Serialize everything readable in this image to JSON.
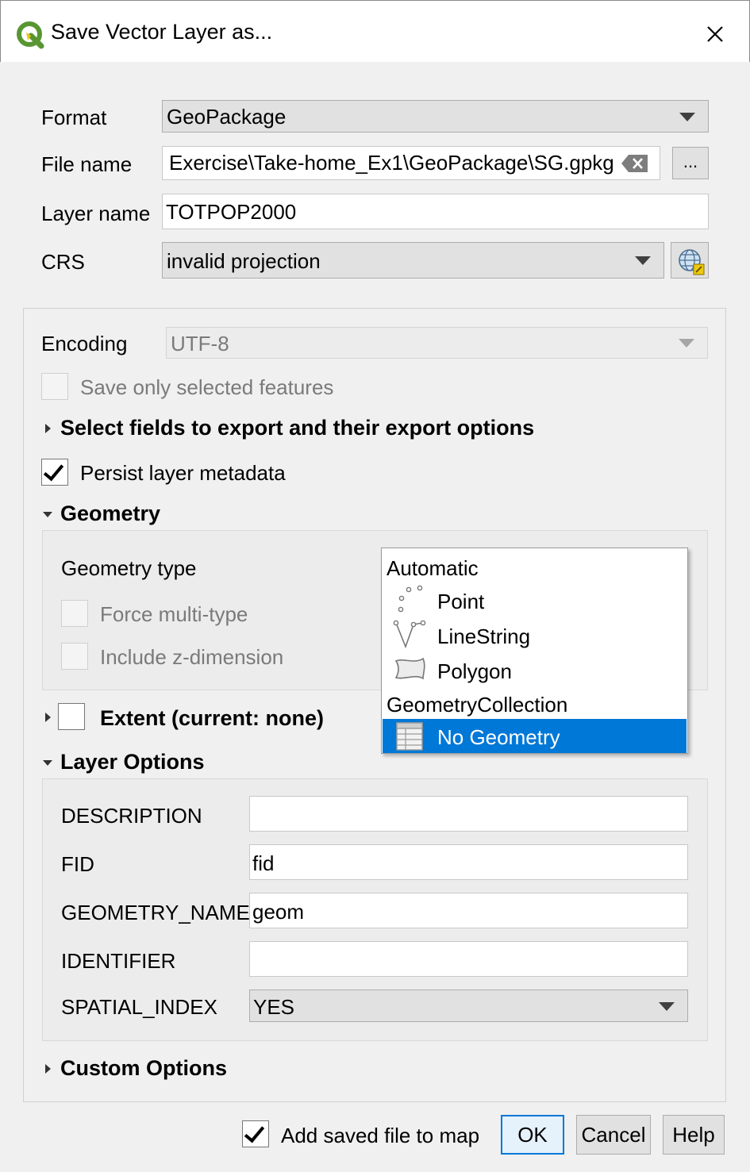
{
  "window": {
    "title": "Save Vector Layer as...",
    "close_glyph": "✕"
  },
  "form": {
    "format_label": "Format",
    "format_value": "GeoPackage",
    "filename_label": "File name",
    "filename_value": "Exercise\\Take-home_Ex1\\GeoPackage\\SG.gpkg",
    "browse_label": "...",
    "layername_label": "Layer name",
    "layername_value": "TOTPOP2000",
    "crs_label": "CRS",
    "crs_value": "invalid projection"
  },
  "options": {
    "encoding_label": "Encoding",
    "encoding_value": "UTF-8",
    "save_selected_label": "Save only selected features",
    "select_fields_label": "Select fields to export and their export options",
    "persist_metadata_label": "Persist layer metadata"
  },
  "geometry": {
    "section_label": "Geometry",
    "type_label": "Geometry type",
    "force_multi_label": "Force multi-type",
    "include_z_label": "Include z-dimension",
    "dropdown_items": [
      {
        "label": "Automatic",
        "icon": "none"
      },
      {
        "label": "Point",
        "icon": "point-icon"
      },
      {
        "label": "LineString",
        "icon": "linestring-icon"
      },
      {
        "label": "Polygon",
        "icon": "polygon-icon"
      },
      {
        "label": "GeometryCollection",
        "icon": "none"
      },
      {
        "label": "No Geometry",
        "icon": "table-icon",
        "selected": true
      }
    ]
  },
  "extent": {
    "section_label": "Extent (current: none)"
  },
  "layer_options": {
    "section_label": "Layer Options",
    "rows": [
      {
        "label": "DESCRIPTION",
        "value": ""
      },
      {
        "label": "FID",
        "value": "fid"
      },
      {
        "label": "GEOMETRY_NAME",
        "value": "geom"
      },
      {
        "label": "IDENTIFIER",
        "value": ""
      },
      {
        "label": "SPATIAL_INDEX",
        "value": "YES"
      }
    ]
  },
  "custom_options": {
    "section_label": "Custom Options"
  },
  "footer": {
    "add_to_map_label": "Add saved file to map",
    "ok_label": "OK",
    "cancel_label": "Cancel",
    "help_label": "Help"
  },
  "colors": {
    "accent": "#0078d7",
    "qgis_green": "#589632",
    "qgis_yellow": "#eec90d"
  }
}
